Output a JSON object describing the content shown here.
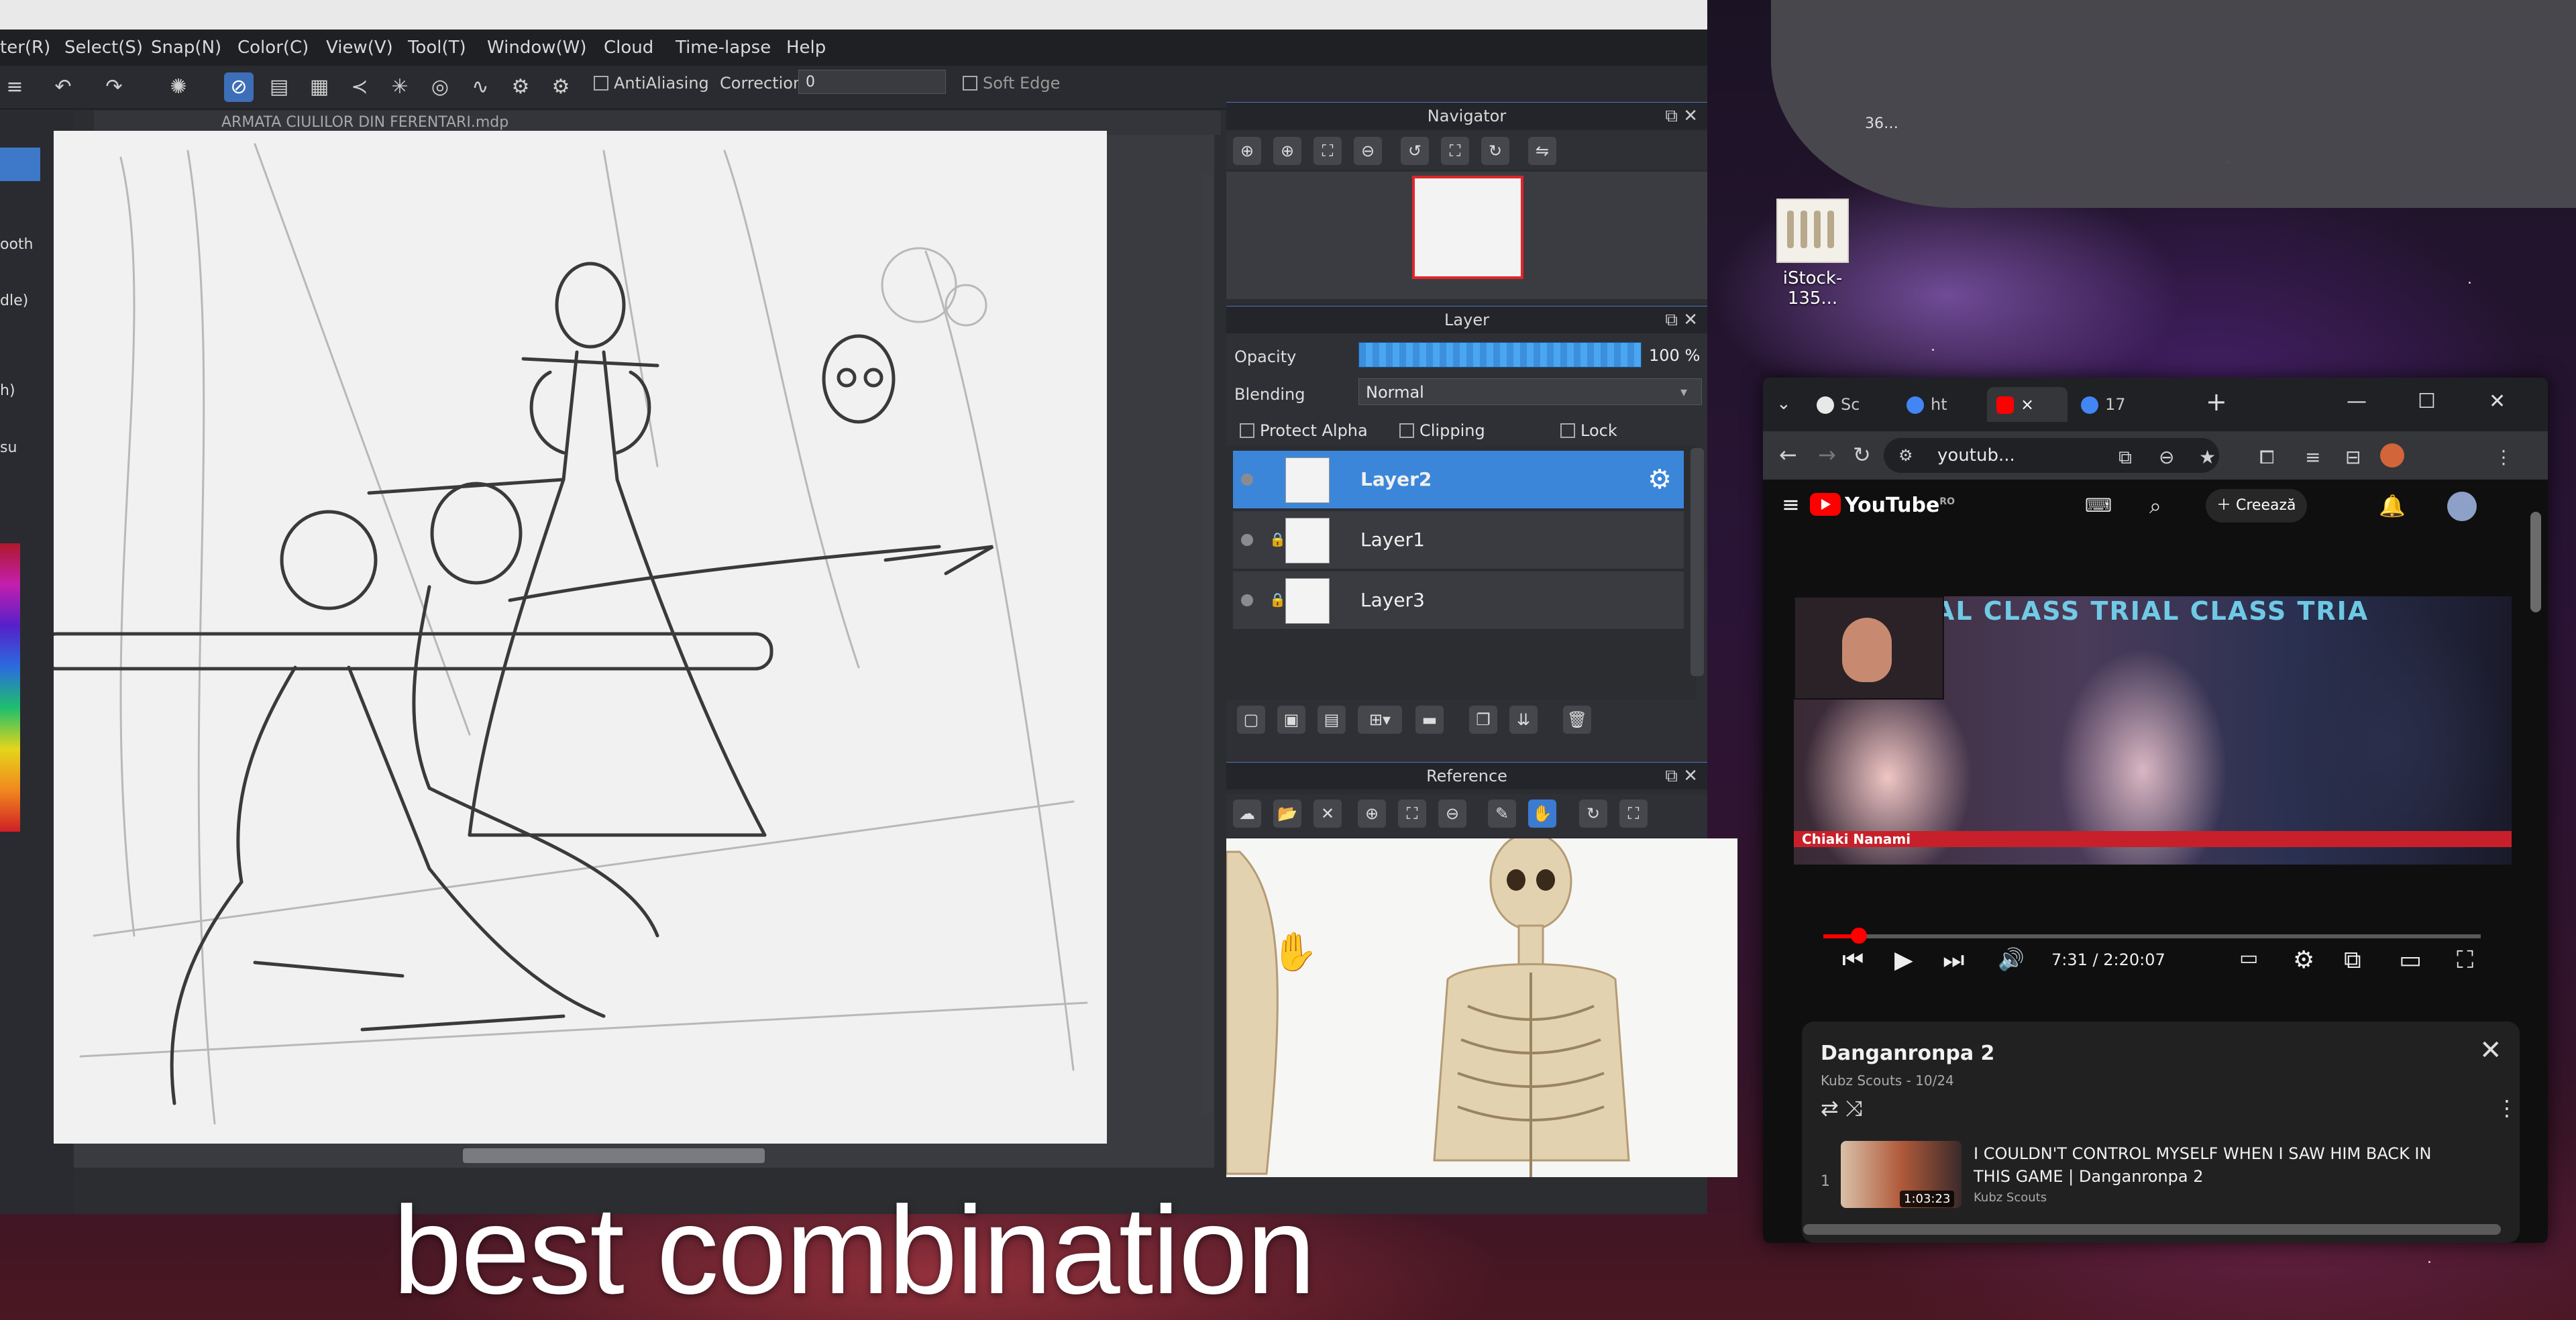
{
  "medibang": {
    "menu": [
      "ter(R)",
      "Select(S)",
      "Snap(N)",
      "Color(C)",
      "View(V)",
      "Tool(T)",
      "Window(W)",
      "Cloud",
      "Time-lapse",
      "Help"
    ],
    "toolbar": {
      "antialiasing": "AntiAliasing",
      "correction_label": "Correction",
      "correction_value": "0",
      "soft_edge": "Soft Edge"
    },
    "left_labels": [
      "ooth",
      "dle)",
      "h)",
      "su"
    ],
    "document_title": "ARMATA CIULILOR DIN FERENTARI.mdp",
    "navigator": {
      "title": "Navigator"
    },
    "layer_panel": {
      "title": "Layer",
      "opacity_label": "Opacity",
      "opacity_value": "100 %",
      "opacity_level": 100,
      "blending_label": "Blending",
      "blending_value": "Normal",
      "protect_alpha": "Protect Alpha",
      "clipping": "Clipping",
      "lock": "Lock",
      "layers": [
        {
          "name": "Layer2",
          "selected": true,
          "locked": false
        },
        {
          "name": "Layer1",
          "selected": false,
          "locked": true
        },
        {
          "name": "Layer3",
          "selected": false,
          "locked": true
        }
      ]
    },
    "reference": {
      "title": "Reference"
    }
  },
  "desktop": {
    "top_label": "36…",
    "icon_label": "iStock-135..."
  },
  "browser": {
    "tabs": [
      {
        "label": "Sc",
        "favicon_color": "#e8e8e8"
      },
      {
        "label": "ht",
        "favicon_color": "#4285f4"
      },
      {
        "label": "",
        "favicon_color": "#ff0000",
        "active": true
      },
      {
        "label": "17",
        "favicon_color": "#4285f4"
      }
    ],
    "close_tab": "×",
    "new_tab": "+",
    "address": "youtub...",
    "window_controls": {
      "minimize": "—",
      "maximize": "☐",
      "close": "✕"
    }
  },
  "youtube": {
    "logo": "YouTube",
    "logo_region": "RO",
    "create_label": "Creează",
    "video_banner": "S TRIAL CLASS TRIAL CLASS TRIA",
    "video_caption": "Chiaki Nanami",
    "time": "7:31 / 2:20:07",
    "progress_fraction": 0.054,
    "playlist": {
      "title": "Danganronpa 2",
      "subtitle": "Kubz Scouts - 10/24",
      "item_number": "1",
      "item_title": "I COULDN'T CONTROL MYSELF WHEN I SAW HIM BACK IN THIS GAME | Danganronpa 2",
      "item_duration": "1:03:23",
      "item_channel": "Kubz Scouts"
    }
  },
  "caption": "best combination",
  "colors": {
    "selected_blue": "#3b86d9",
    "youtube_red": "#ff0000",
    "caption_white": "#ffffff"
  }
}
